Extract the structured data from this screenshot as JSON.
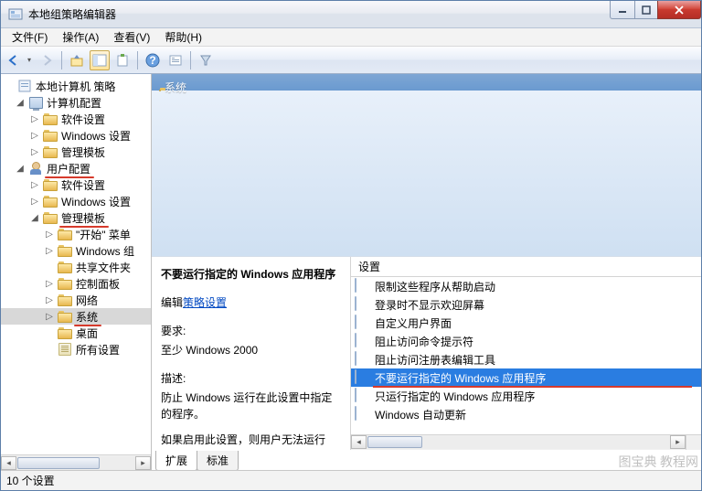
{
  "title": "本地组策略编辑器",
  "menu": {
    "file": "文件(F)",
    "action": "操作(A)",
    "view": "查看(V)",
    "help": "帮助(H)"
  },
  "tree": {
    "root": "本地计算机 策略",
    "comp_config": "计算机配置",
    "software_settings_1": "软件设置",
    "windows_settings_1": "Windows 设置",
    "admin_templates_1": "管理模板",
    "user_config": "用户配置",
    "software_settings_2": "软件设置",
    "windows_settings_2": "Windows 设置",
    "admin_templates_2": "管理模板",
    "start_menu": "\"开始\" 菜单",
    "windows_components": "Windows 组",
    "shared_folders": "共享文件夹",
    "control_panel": "控制面板",
    "network": "网络",
    "system": "系统",
    "desktop": "桌面",
    "all_settings": "所有设置"
  },
  "path": {
    "label": "系统"
  },
  "detail": {
    "title": "不要运行指定的 Windows 应用程序",
    "edit_prefix": "编辑",
    "edit_link": "策略设置",
    "req_label": "要求:",
    "req_val": "至少 Windows 2000",
    "desc_label": "描述:",
    "desc1": "防止 Windows 运行在此设置中指定的程序。",
    "desc2": "如果启用此设置，则用户无法运行"
  },
  "settings": {
    "header": "设置",
    "items": [
      "限制这些程序从帮助启动",
      "登录时不显示欢迎屏幕",
      "自定义用户界面",
      "阻止访问命令提示符",
      "阻止访问注册表编辑工具",
      "不要运行指定的 Windows 应用程序",
      "只运行指定的 Windows 应用程序",
      "Windows 自动更新"
    ]
  },
  "tabs": {
    "extend": "扩展",
    "standard": "标准"
  },
  "status": "10 个设置",
  "watermark": "图宝典 教程网"
}
